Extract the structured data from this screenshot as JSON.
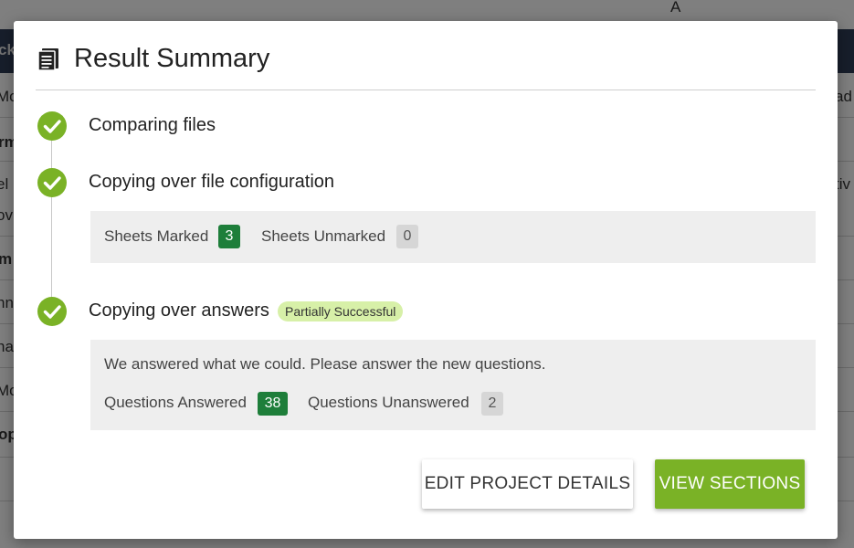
{
  "background": {
    "top_right_text": "A",
    "left_fragments": [
      "ck",
      "Mo",
      "rm",
      "el",
      "ov",
      "m",
      "nn",
      "na",
      "Mo",
      "op"
    ],
    "right_fragments": [
      "ad",
      "tiv"
    ]
  },
  "modal": {
    "title": "Result Summary",
    "icon": "document-list-icon",
    "steps": [
      {
        "label": "Comparing files",
        "status_icon": "check-circle-icon"
      },
      {
        "label": "Copying over file configuration",
        "status_icon": "check-circle-icon"
      },
      {
        "label": "Copying over answers",
        "status_icon": "check-circle-icon",
        "status_badge": "Partially Successful"
      }
    ],
    "sheets_panel": {
      "marked_label": "Sheets Marked",
      "marked_count": "3",
      "unmarked_label": "Sheets Unmarked",
      "unmarked_count": "0"
    },
    "answers_panel": {
      "message": "We answered what we could. Please answer the new questions.",
      "answered_label": "Questions Answered",
      "answered_count": "38",
      "unanswered_label": "Questions Unanswered",
      "unanswered_count": "2"
    },
    "buttons": {
      "edit_project": "EDIT PROJECT DETAILS",
      "view_sections": "VIEW SECTIONS"
    }
  },
  "colors": {
    "accent_green": "#7ab226",
    "count_green": "#1e7e3a",
    "partial_badge_bg": "#d7f0a8",
    "overlay": "rgba(0,0,0,0.5)"
  }
}
